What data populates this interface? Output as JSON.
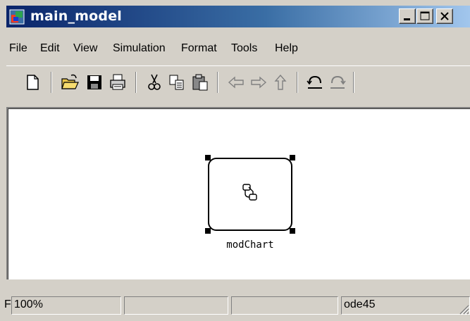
{
  "window": {
    "title": "main_model",
    "icon": "simulink-model-icon",
    "controls": [
      "minimize-icon",
      "maximize-icon",
      "close-icon"
    ]
  },
  "menubar": {
    "items": [
      "File",
      "Edit",
      "View",
      "Simulation",
      "Format",
      "Tools",
      "Help"
    ]
  },
  "toolbar": {
    "buttons": [
      {
        "icon": "new-document-icon"
      },
      {
        "icon": "open-folder-icon"
      },
      {
        "icon": "save-icon"
      },
      {
        "icon": "print-icon"
      },
      {
        "icon": "cut-icon"
      },
      {
        "icon": "copy-icon"
      },
      {
        "icon": "paste-icon"
      },
      {
        "icon": "back-arrow-icon"
      },
      {
        "icon": "forward-arrow-icon"
      },
      {
        "icon": "up-arrow-icon"
      },
      {
        "icon": "undo-icon"
      },
      {
        "icon": "redo-icon"
      }
    ]
  },
  "canvas": {
    "block": {
      "name": "modChart",
      "icon": "stateflow-chart-icon",
      "selected": true
    }
  },
  "statusbar": {
    "prefix": "F",
    "zoom": "100%",
    "cell2": "",
    "cell3": "",
    "solver": "ode45"
  }
}
